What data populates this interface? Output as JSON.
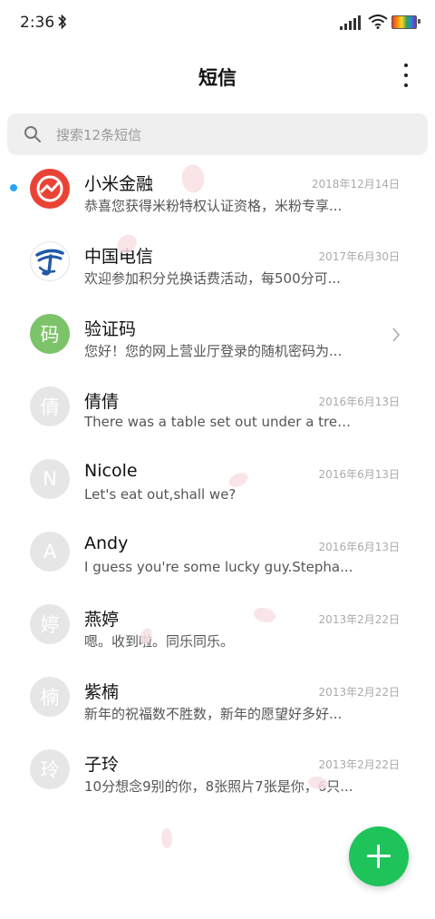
{
  "status": {
    "time": "2:36"
  },
  "header": {
    "title": "短信"
  },
  "search": {
    "placeholder": "搜索12条短信"
  },
  "conversations": [
    {
      "name": "小米金融",
      "snippet": "恭喜您获得米粉特权认证资格，米粉专享...",
      "date": "2018年12月14日",
      "unread": true,
      "avatar": "mi-finance-logo"
    },
    {
      "name": "中国电信",
      "snippet": "欢迎参加积分兑换话费活动，每500分可...",
      "date": "2017年6月30日",
      "avatar": "china-telecom-logo"
    },
    {
      "name": "验证码",
      "snippet": "您好！您的网上营业厅登录的随机密码为...",
      "avatar_text": "码",
      "group": true
    },
    {
      "name": "倩倩",
      "snippet": "There was a table set out under a tree i...",
      "date": "2016年6月13日",
      "avatar_text": "倩"
    },
    {
      "name": "Nicole",
      "snippet": "Let's eat out,shall we?",
      "date": "2016年6月13日",
      "avatar_text": "N"
    },
    {
      "name": "Andy",
      "snippet": "I guess you're some lucky guy.Stepha...",
      "date": "2016年6月13日",
      "avatar_text": "A"
    },
    {
      "name": "燕婷",
      "snippet": "嗯。收到啦。同乐同乐。",
      "date": "2013年2月22日",
      "avatar_text": "婷"
    },
    {
      "name": "紫楠",
      "snippet": "新年的祝福数不胜数，新年的愿望好多好...",
      "date": "2013年2月22日",
      "avatar_text": "楠"
    },
    {
      "name": "子玲",
      "snippet": "10分想念9别的你，8张照片7张是你，6只...",
      "date": "2013年2月22日",
      "avatar_text": "玲"
    }
  ],
  "colors": {
    "accent": "#1ec35a",
    "unread": "#2aa4ff"
  }
}
